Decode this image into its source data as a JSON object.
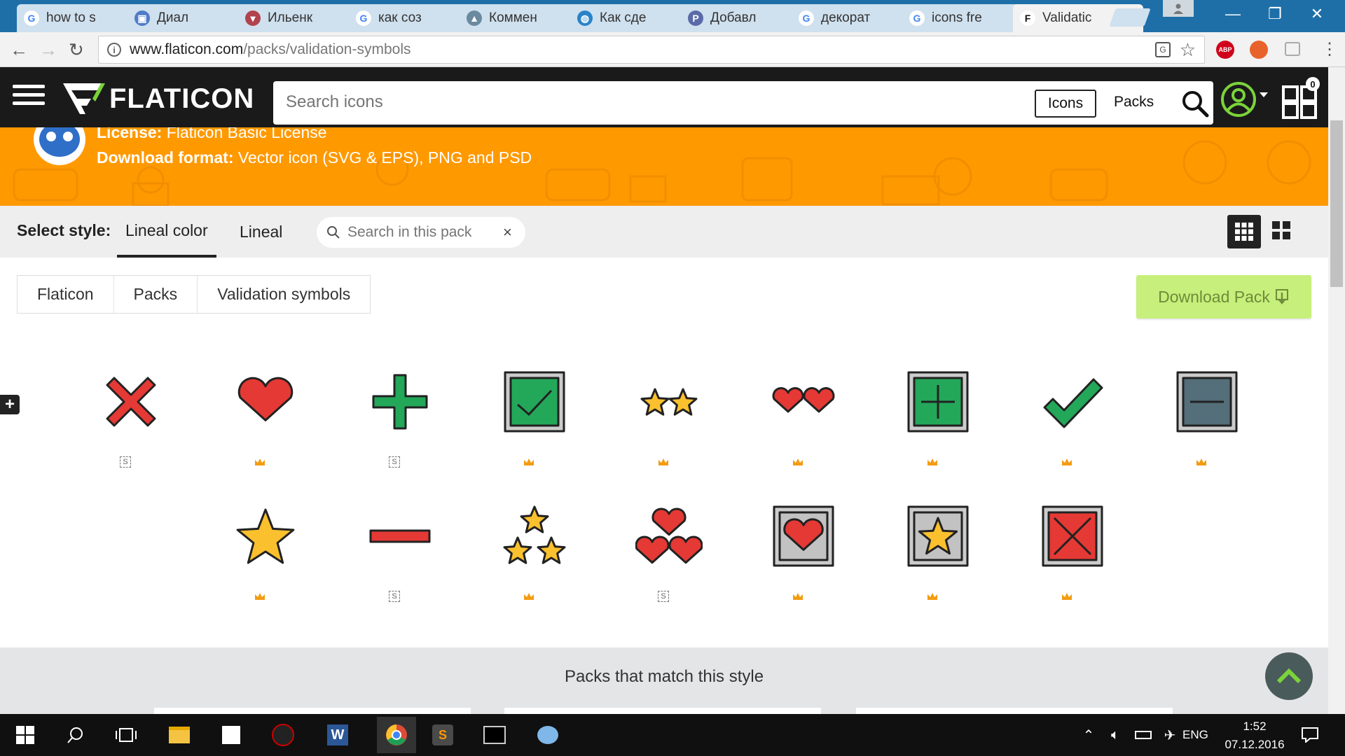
{
  "browser": {
    "tabs": [
      {
        "title": "how to s",
        "favicon": "google-icon"
      },
      {
        "title": "Диал",
        "favicon": "dialog-icon"
      },
      {
        "title": "Ильенк",
        "favicon": "basket-icon"
      },
      {
        "title": "как соз",
        "favicon": "google-icon"
      },
      {
        "title": "Коммен",
        "favicon": "python-icon"
      },
      {
        "title": "Как сде",
        "favicon": "globe-icon"
      },
      {
        "title": "Добавл",
        "favicon": "php-icon"
      },
      {
        "title": "декорат",
        "favicon": "google-icon"
      },
      {
        "title": "icons fre",
        "favicon": "google-icon"
      },
      {
        "title": "Validatic",
        "favicon": "flaticon-icon",
        "active": true
      }
    ],
    "url_host": "www.flaticon.com",
    "url_path": "/packs/validation-symbols",
    "ext_badges": [
      "ABP"
    ]
  },
  "site": {
    "logo_text": "FLATICON",
    "search_placeholder": "Search icons",
    "btn_icons": "Icons",
    "btn_packs": "Packs",
    "collections_count": "0"
  },
  "banner": {
    "license_label": "License:",
    "license_value": "Flaticon Basic License",
    "format_label": "Download format:",
    "format_value": "Vector icon (SVG & EPS), PNG and PSD",
    "bg_color": "#ff9900"
  },
  "style_bar": {
    "label": "Select style:",
    "styles": [
      "Lineal color",
      "Lineal"
    ],
    "active_style": "Lineal color",
    "pack_search_placeholder": "Search in this pack",
    "clear_symbol": "×"
  },
  "breadcrumb": [
    "Flaticon",
    "Packs",
    "Validation symbols"
  ],
  "download_pack_label": "Download Pack",
  "plus_tab_symbol": "+",
  "icons": [
    {
      "name": "cross-icon",
      "badge": "S"
    },
    {
      "name": "heart-icon",
      "badge": "premium"
    },
    {
      "name": "plus-icon",
      "badge": "S"
    },
    {
      "name": "check-square-icon",
      "badge": "premium"
    },
    {
      "name": "two-stars-icon",
      "badge": "premium"
    },
    {
      "name": "two-hearts-icon",
      "badge": "premium"
    },
    {
      "name": "plus-square-icon",
      "badge": "premium"
    },
    {
      "name": "check-icon",
      "badge": "premium"
    },
    {
      "name": "minus-square-icon",
      "badge": "premium"
    },
    {
      "name": "star-icon",
      "badge": "premium"
    },
    {
      "name": "minus-icon",
      "badge": "S"
    },
    {
      "name": "three-stars-icon",
      "badge": "premium"
    },
    {
      "name": "three-hearts-icon",
      "badge": "S"
    },
    {
      "name": "heart-square-icon",
      "badge": "premium"
    },
    {
      "name": "star-square-icon",
      "badge": "premium"
    },
    {
      "name": "cross-square-icon",
      "badge": "premium"
    }
  ],
  "badge_s_text": "S",
  "packs_heading": "Packs that match this style",
  "taskbar": {
    "lang": "ENG",
    "time": "1:52",
    "date": "07.12.2016"
  }
}
